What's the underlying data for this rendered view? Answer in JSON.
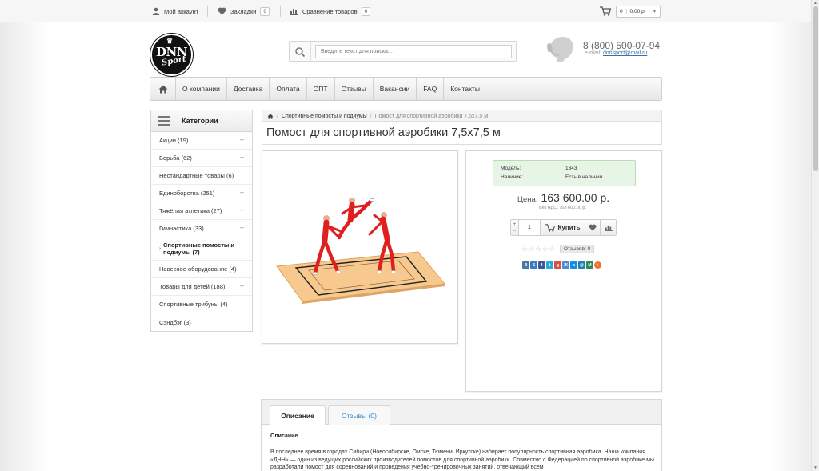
{
  "topbar": {
    "account": "Мой аккаунт",
    "bookmarks": "Закладки",
    "bookmarks_count": "0",
    "compare": "Сравнение товаров",
    "compare_count": "0",
    "cart_count": "0",
    "cart_total": "0.00 р."
  },
  "header": {
    "logo_text": "DNN",
    "logo_sub": "Sport",
    "search_placeholder": "Введите текст для поиска...",
    "phone": "8 (800) 500-07-94",
    "email_label": "e-mail:",
    "email": "dnnsport@mail.ru"
  },
  "menu": [
    "О компании",
    "Доставка",
    "Оплата",
    "ОПТ",
    "Отзывы",
    "Вакансии",
    "FAQ",
    "Контакты"
  ],
  "categories": {
    "title": "Категории",
    "items": [
      {
        "label": "Акции (19)",
        "plus": "+"
      },
      {
        "label": "Борьба (62)",
        "plus": "+"
      },
      {
        "label": "Нестандартные товары (6)",
        "plus": ""
      },
      {
        "label": "Единоборства (251)",
        "plus": "+"
      },
      {
        "label": "Тяжёлая атлетика (27)",
        "plus": "+"
      },
      {
        "label": "Гимнастика (33)",
        "plus": "+"
      },
      {
        "label": "Спортивные помосты и подиумы (7)",
        "plus": "",
        "active": true
      },
      {
        "label": "Навесное оборудование (4)",
        "plus": ""
      },
      {
        "label": "Товары для детей (188)",
        "plus": "+"
      },
      {
        "label": "Спортивные трибуны (4)",
        "plus": ""
      },
      {
        "label": "Сэндбэг (3)",
        "plus": ""
      }
    ]
  },
  "breadcrumb": {
    "parent": "Спортивные помосты и подиумы",
    "sep": "/",
    "current": "Помост для спортивной аэробики 7,5х7,5 м"
  },
  "product": {
    "title": "Помост для спортивной аэробики 7,5х7,5 м",
    "model_label": "Модель:",
    "model_value": "1343",
    "stock_label": "Наличие:",
    "stock_value": "Есть в наличии",
    "price_label": "Цена:",
    "price": "163 600.00 р.",
    "no_vat": "Без НДС: 163 600.00 р.",
    "qty": "1",
    "buy_label": "Купить",
    "stars": "☆☆☆☆☆",
    "reviews_btn": "Отзывов: 0",
    "rating_value": 0
  },
  "share": [
    {
      "icon": "vk-icon",
      "glyph": "В",
      "color": "#4c75a3"
    },
    {
      "icon": "bookmark-icon",
      "glyph": "Б",
      "color": "#3b79c2"
    },
    {
      "icon": "facebook-icon",
      "glyph": "f",
      "color": "#3b5998"
    },
    {
      "icon": "twitter-icon",
      "glyph": "t",
      "color": "#2aa9e0"
    },
    {
      "icon": "google-plus-icon",
      "glyph": "g",
      "color": "#dc4e41"
    },
    {
      "icon": "livejournal-icon",
      "glyph": "Ж",
      "color": "#4a8cd4"
    },
    {
      "icon": "odnoklassniki-icon",
      "glyph": "о",
      "color": "#168de2"
    },
    {
      "icon": "email-icon",
      "glyph": "@",
      "color": "#1f7dbe"
    },
    {
      "icon": "myworld-icon",
      "glyph": "М",
      "color": "#2e8b57"
    },
    {
      "icon": "more-icon",
      "glyph": "+",
      "color": "#f0702d"
    }
  ],
  "tabs": {
    "description": "Описание",
    "reviews": "Отзывы (0)"
  },
  "description": {
    "heading": "Описание",
    "text": "В последнее время в городах Сибири (Новосибирске, Омске, Тюмени, Иркутске) набирает популярность спортивная аэробика. Наша компания «ДНН» — один из ведущих российских производителей помостов для спортивной аэробики. Совместно с Федерацией по спортивной аэробике мы разработали помост для соревнований и проведения учебно-тренировочных занятий, отвечающий всем"
  },
  "colors": {
    "accent": "#3b8bc5",
    "stock_bg": "#e7f5e6",
    "athlete_red": "#e02020",
    "mat_color": "#f7c98f"
  }
}
